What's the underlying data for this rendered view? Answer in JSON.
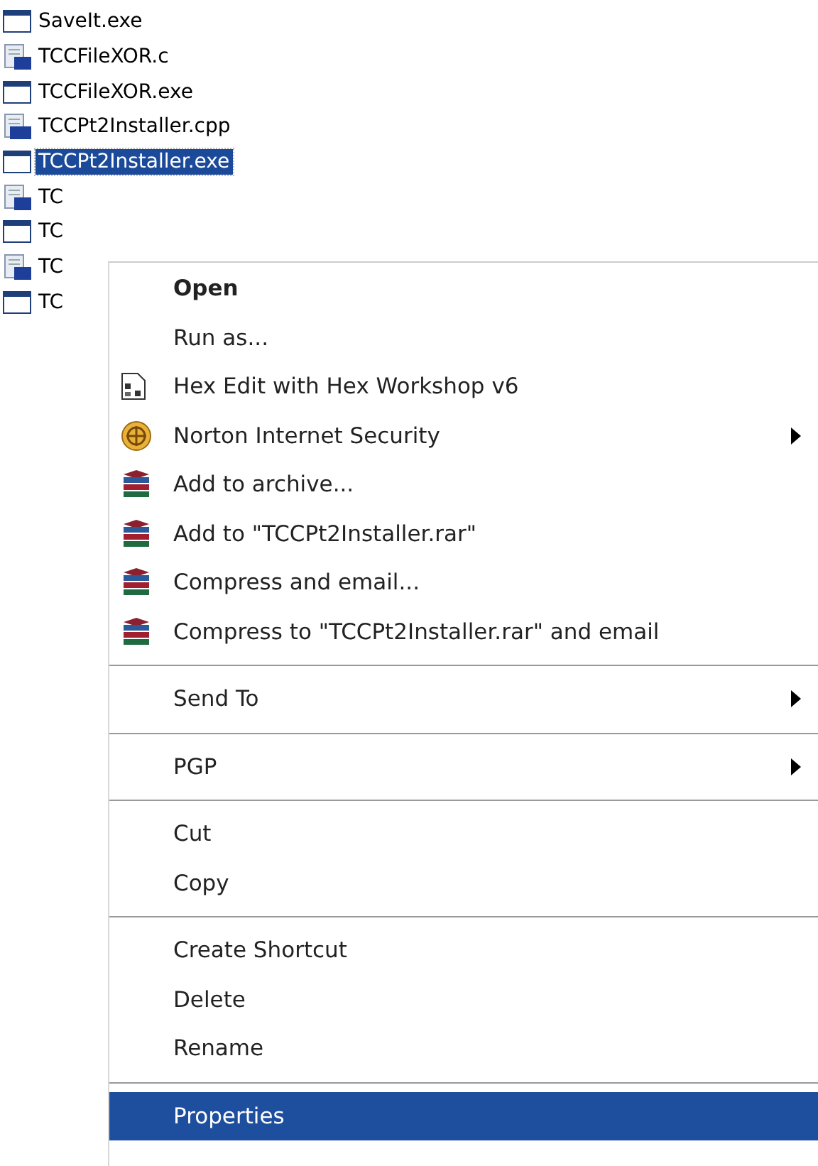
{
  "files": [
    {
      "name": "SaveIt.exe",
      "kind": "exe",
      "selected": false
    },
    {
      "name": "TCCFileXOR.c",
      "kind": "c",
      "selected": false
    },
    {
      "name": "TCCFileXOR.exe",
      "kind": "exe",
      "selected": false
    },
    {
      "name": "TCCPt2Installer.cpp",
      "kind": "cpp",
      "selected": false
    },
    {
      "name": "TCCPt2Installer.exe",
      "kind": "exe",
      "selected": true
    },
    {
      "name": "TC",
      "kind": "c",
      "selected": false
    },
    {
      "name": "TC",
      "kind": "exe",
      "selected": false
    },
    {
      "name": "TC",
      "kind": "c",
      "selected": false
    },
    {
      "name": "TC",
      "kind": "exe",
      "selected": false
    }
  ],
  "context_menu": {
    "groups": [
      [
        {
          "label": "Open",
          "kind": "plain",
          "default": true,
          "submenu": false,
          "selected": false
        },
        {
          "label": "Run as...",
          "kind": "plain",
          "default": false,
          "submenu": false,
          "selected": false
        },
        {
          "label": "Hex Edit with Hex Workshop v6",
          "kind": "hex",
          "default": false,
          "submenu": false,
          "selected": false
        },
        {
          "label": "Norton Internet Security",
          "kind": "security",
          "default": false,
          "submenu": true,
          "selected": false
        },
        {
          "label": "Add to archive...",
          "kind": "archive",
          "default": false,
          "submenu": false,
          "selected": false
        },
        {
          "label": "Add to \"TCCPt2Installer.rar\"",
          "kind": "archive",
          "default": false,
          "submenu": false,
          "selected": false
        },
        {
          "label": "Compress and email...",
          "kind": "archive",
          "default": false,
          "submenu": false,
          "selected": false
        },
        {
          "label": "Compress to \"TCCPt2Installer.rar\" and email",
          "kind": "archive",
          "default": false,
          "submenu": false,
          "selected": false
        }
      ],
      [
        {
          "label": "Send To",
          "kind": "plain",
          "default": false,
          "submenu": true,
          "selected": false
        }
      ],
      [
        {
          "label": "PGP",
          "kind": "plain",
          "default": false,
          "submenu": true,
          "selected": false
        }
      ],
      [
        {
          "label": "Cut",
          "kind": "plain",
          "default": false,
          "submenu": false,
          "selected": false
        },
        {
          "label": "Copy",
          "kind": "plain",
          "default": false,
          "submenu": false,
          "selected": false
        }
      ],
      [
        {
          "label": "Create Shortcut",
          "kind": "plain",
          "default": false,
          "submenu": false,
          "selected": false
        },
        {
          "label": "Delete",
          "kind": "plain",
          "default": false,
          "submenu": false,
          "selected": false
        },
        {
          "label": "Rename",
          "kind": "plain",
          "default": false,
          "submenu": false,
          "selected": false
        }
      ],
      [
        {
          "label": "Properties",
          "kind": "plain",
          "default": false,
          "submenu": false,
          "selected": true
        }
      ]
    ]
  }
}
